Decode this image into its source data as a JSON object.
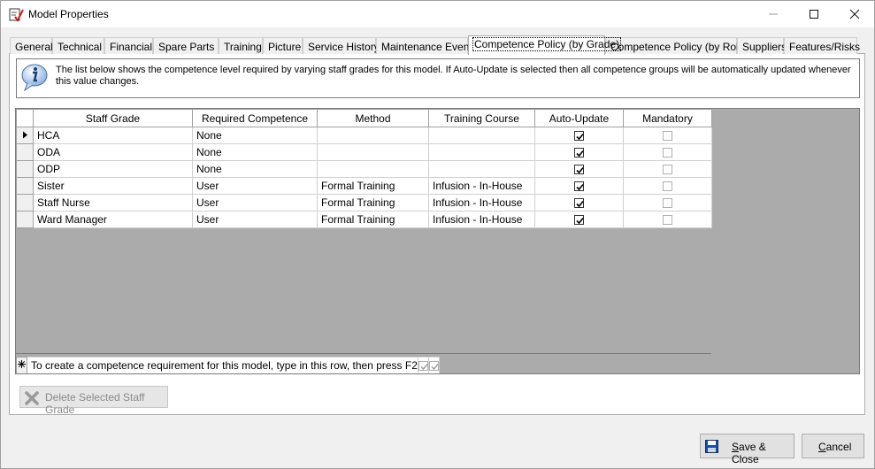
{
  "window": {
    "title": "Model Properties"
  },
  "tabs": [
    {
      "label": "General"
    },
    {
      "label": "Technical"
    },
    {
      "label": "Financial"
    },
    {
      "label": "Spare Parts"
    },
    {
      "label": "Training"
    },
    {
      "label": "Picture"
    },
    {
      "label": "Service History"
    },
    {
      "label": "Maintenance Events"
    },
    {
      "label": "Competence Policy (by Grade)"
    },
    {
      "label": "Competence Policy (by Role)"
    },
    {
      "label": "Suppliers"
    },
    {
      "label": "Features/Risks"
    }
  ],
  "info": {
    "text": "The list below shows the competence level required by varying staff grades for this model. If Auto-Update is selected then all competence groups will be automatically updated whenever this value changes."
  },
  "grid": {
    "columns": [
      "Staff Grade",
      "Required Competence",
      "Method",
      "Training Course",
      "Auto-Update",
      "Mandatory"
    ],
    "rows": [
      {
        "grade": "HCA",
        "competence": "None",
        "method": "",
        "course": "",
        "auto_update": true,
        "mandatory": false
      },
      {
        "grade": "ODA",
        "competence": "None",
        "method": "",
        "course": "",
        "auto_update": true,
        "mandatory": false
      },
      {
        "grade": "ODP",
        "competence": "None",
        "method": "",
        "course": "",
        "auto_update": true,
        "mandatory": false
      },
      {
        "grade": "Sister",
        "competence": "User",
        "method": "Formal Training",
        "course": "Infusion - In-House",
        "auto_update": true,
        "mandatory": false
      },
      {
        "grade": "Staff Nurse",
        "competence": "User",
        "method": "Formal Training",
        "course": "Infusion - In-House",
        "auto_update": true,
        "mandatory": false
      },
      {
        "grade": "Ward Manager",
        "competence": "User",
        "method": "Formal Training",
        "course": "Infusion - In-House",
        "auto_update": true,
        "mandatory": false
      }
    ],
    "new_row_hint": "To create a competence requirement for this model, type in this row, then press F2"
  },
  "buttons": {
    "delete": "Delete Selected Staff Grade",
    "save_prefix": "",
    "save_key": "S",
    "save_rest": "ave & Close",
    "cancel_key": "C",
    "cancel_rest": "ancel"
  }
}
